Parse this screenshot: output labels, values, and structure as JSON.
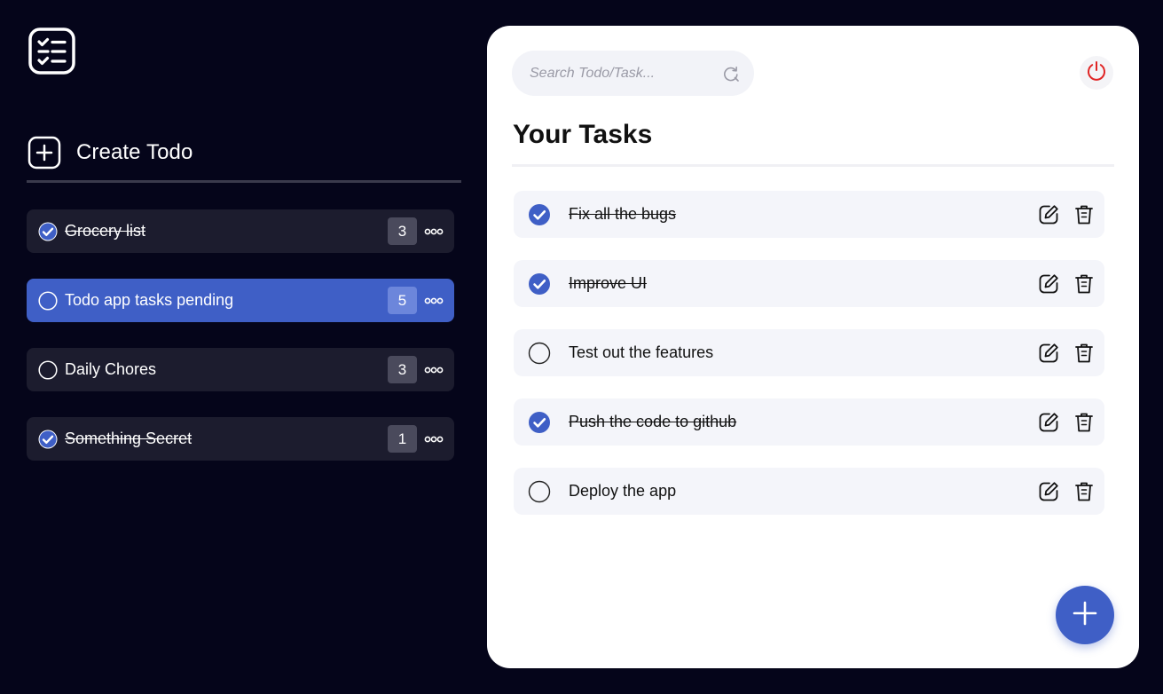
{
  "colors": {
    "background": "#05051a",
    "accent": "#3f5fc6",
    "sidebar_item_bg": "#1c1c2e",
    "panel_bg": "#ffffff",
    "task_bg": "#f4f5fa",
    "power_red": "#e02424"
  },
  "sidebar": {
    "logo_icon": "checklist-logo-icon",
    "create_icon": "plus-square-icon",
    "create_label": "Create Todo",
    "todos": [
      {
        "label": "Grocery list",
        "count": "3",
        "done": true,
        "active": false
      },
      {
        "label": "Todo app tasks pending",
        "count": "5",
        "done": false,
        "active": true
      },
      {
        "label": "Daily Chores",
        "count": "3",
        "done": false,
        "active": false
      },
      {
        "label": "Something Secret",
        "count": "1",
        "done": true,
        "active": false
      }
    ],
    "more_icon": "more-dots-icon"
  },
  "main": {
    "search": {
      "placeholder": "Search Todo/Task...",
      "value": "",
      "icon": "search-refresh-icon"
    },
    "power_icon": "power-icon",
    "title": "Your Tasks",
    "tasks": [
      {
        "label": "Fix all the bugs",
        "done": true
      },
      {
        "label": "Improve UI",
        "done": true
      },
      {
        "label": "Test out the features",
        "done": false
      },
      {
        "label": "Push the code to github",
        "done": true
      },
      {
        "label": "Deploy the app",
        "done": false
      }
    ],
    "edit_icon": "edit-icon",
    "delete_icon": "trash-icon",
    "fab_icon": "plus-icon"
  }
}
